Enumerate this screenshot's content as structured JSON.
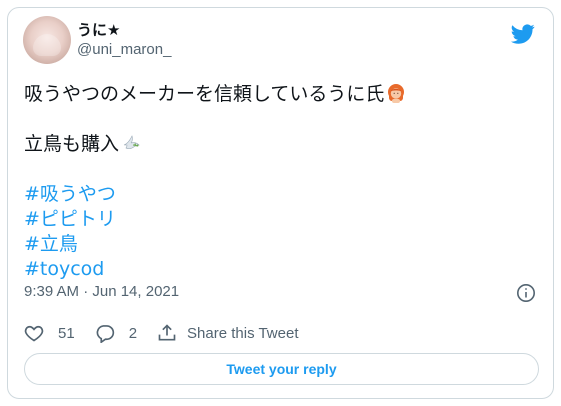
{
  "user": {
    "display_name": "うに★",
    "handle": "@uni_maron_"
  },
  "tweet": {
    "lines": [
      "吸うやつのメーカーを信頼しているうに氏",
      "立鳥も購入"
    ],
    "emojis": [
      "person-with-red-hair-emoji",
      "dove-emoji"
    ],
    "hashtags": [
      "#吸うやつ",
      "#ピピトリ",
      "#立鳥",
      "#toycod"
    ],
    "timestamp": "9:39 AM · Jun 14, 2021"
  },
  "actions": {
    "likes": "51",
    "replies": "2",
    "share_label": "Share this Tweet"
  },
  "reply_button_label": "Tweet your reply",
  "colors": {
    "accent": "#1d9bf0",
    "text": "#0f1419",
    "muted": "#536471",
    "border": "#cfd9de"
  },
  "icons": [
    "twitter-bird-icon",
    "info-icon",
    "heart-icon",
    "reply-icon",
    "share-icon"
  ]
}
